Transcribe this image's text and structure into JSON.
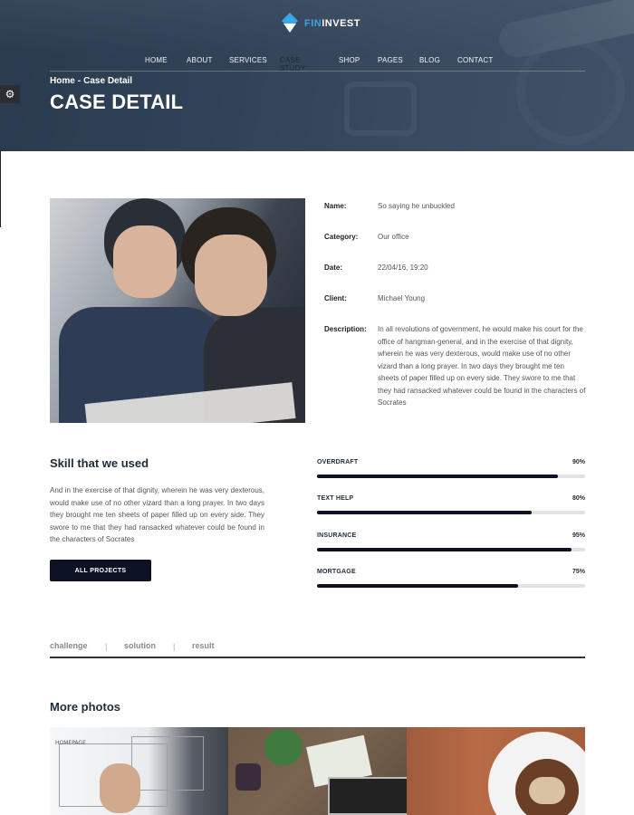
{
  "brand": {
    "name_part1": "FIN",
    "name_part2": "INVEST"
  },
  "nav": {
    "items": [
      "HOME",
      "ABOUT",
      "SERVICES",
      "CASE STUDY",
      "SHOP",
      "PAGES",
      "BLOG",
      "CONTACT"
    ],
    "active": "CASE STUDY"
  },
  "breadcrumb": {
    "home": "Home",
    "separator": "-",
    "current": "Case Detail"
  },
  "page_title": "CASE DETAIL",
  "details": {
    "name_label": "Name:",
    "name_value": "So saying he unbuckled",
    "category_label": "Category:",
    "category_value": "Our office",
    "date_label": "Date:",
    "date_value": "22/04/16, 19:20",
    "client_label": "Client:",
    "client_value": "Michael Young",
    "description_label": "Description:",
    "description_value": "In all revolutions of government, he would make his court for the office of hangman-general, and in the exercise of that dignity, wherein he was very dexterous, would make use of no other vizard than a long prayer. In two days they brought me ten sheets of paper filled up on every side. They swore to me that they had ransacked whatever could be found in the characters of Socrates"
  },
  "skills": {
    "title": "Skill that we used",
    "text": "And in the exercise of that dignity, wherein he was very dexterous, would make use of no other vizard than a long prayer. In two days they brought me ten sheets of paper filled up on every side. They swore to me that they had ransacked whatever could be found in the characters of Socrates",
    "button": "ALL PROJECTS",
    "bars": [
      {
        "name": "OVERDRAFT",
        "percent_label": "90%",
        "value": 0.9
      },
      {
        "name": "TEXT HELP",
        "percent_label": "80%",
        "value": 0.8
      },
      {
        "name": "INSURANCE",
        "percent_label": "95%",
        "value": 0.95
      },
      {
        "name": "MORTGAGE",
        "percent_label": "75%",
        "value": 0.75
      }
    ]
  },
  "tabs": {
    "items": [
      "challenge",
      "solution",
      "result"
    ],
    "separator": "|"
  },
  "more_photos": {
    "title": "More photos",
    "photo1_text": "HOMEPAGE"
  },
  "colors": {
    "accent": "#39a6e6",
    "dark": "#0d1124",
    "hero": "#3b4c60"
  },
  "icons": {
    "settings": "gear-icon"
  }
}
